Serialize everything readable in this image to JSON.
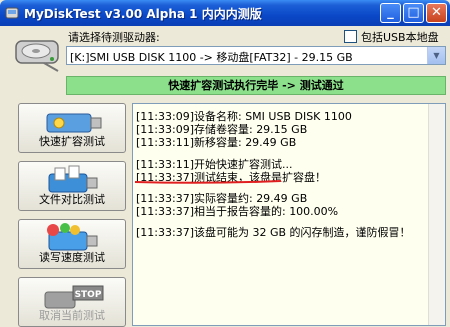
{
  "window": {
    "title": "MyDiskTest v3.00 Alpha 1 内内内测版",
    "minimize": "_",
    "maximize": "□",
    "close": "✕"
  },
  "drive_select": {
    "label": "请选择待测驱动器:",
    "usb_local_label": "包括USB本地盘",
    "usb_local_checked": false,
    "selected_drive": "[K:]SMI USB DISK 1100 -> 移动盘[FAT32] - 29.15 GB"
  },
  "status": {
    "text": "快速扩容测试执行完毕 -> 测试通过",
    "color": "#8ce08c"
  },
  "buttons": [
    {
      "label": "快速扩容测试",
      "icon": "quick-expand-test-icon",
      "enabled": true
    },
    {
      "label": "文件对比测试",
      "icon": "file-compare-icon",
      "enabled": true
    },
    {
      "label": "读写速度测试",
      "icon": "speed-test-icon",
      "enabled": true
    },
    {
      "label": "取消当前测试",
      "icon": "stop-icon",
      "enabled": false
    }
  ],
  "log": {
    "lines": [
      "[11:33:09]设备名称: SMI USB DISK 1100",
      "[11:33:09]存储卷容量: 29.15 GB",
      "[11:33:11]新移容量: 29.49 GB",
      "[11:33:11]开始快速扩容测试...",
      "[11:33:37]测试结束，该盘是扩容盘！",
      "[11:33:37]实际容量约: 29.49 GB",
      "[11:33:37]相当于报告容量的: 100.00%",
      "[11:33:37]该盘可能为 32 GB 的闪存制造，谨防假冒！"
    ]
  }
}
